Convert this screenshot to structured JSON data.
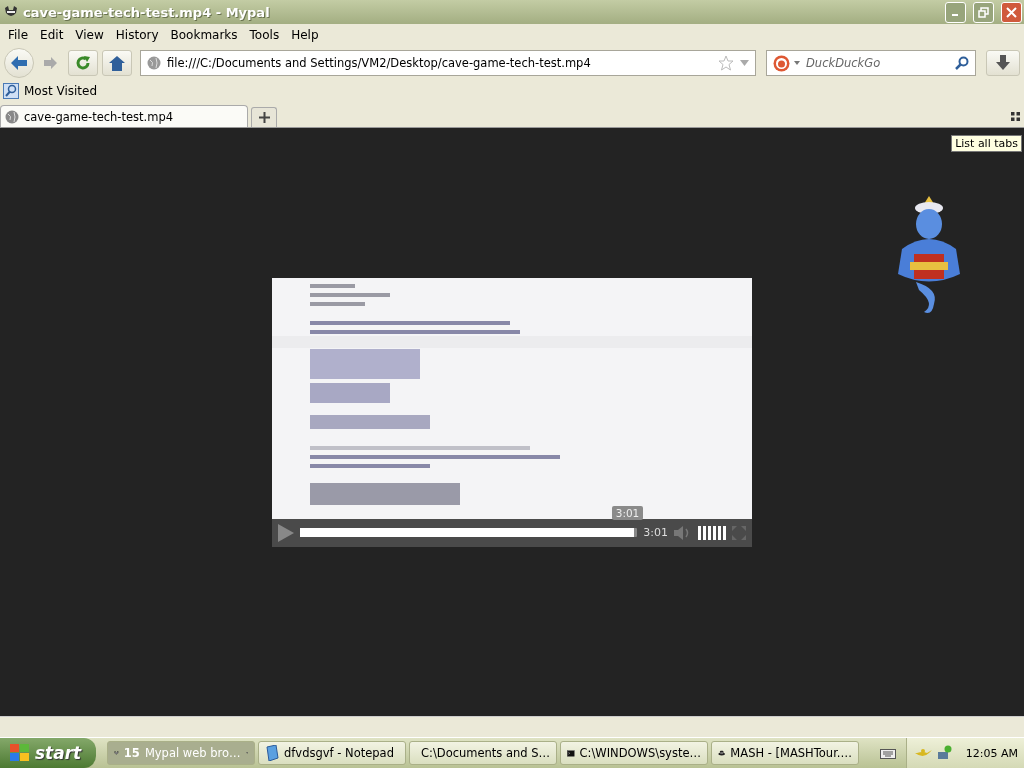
{
  "window": {
    "title": "cave-game-tech-test.mp4 - Mypal"
  },
  "menu": [
    {
      "label": "File"
    },
    {
      "label": "Edit"
    },
    {
      "label": "View"
    },
    {
      "label": "History"
    },
    {
      "label": "Bookmarks"
    },
    {
      "label": "Tools"
    },
    {
      "label": "Help"
    }
  ],
  "address": {
    "value": "file:///C:/Documents and Settings/VM2/Desktop/cave-game-tech-test.mp4"
  },
  "search": {
    "placeholder": "DuckDuckGo"
  },
  "bookmarks": [
    {
      "label": "Most Visited"
    }
  ],
  "tabs": [
    {
      "label": "cave-game-tech-test.mp4",
      "selected": true
    }
  ],
  "tooltip": "List all tabs",
  "video": {
    "kind": "picture",
    "player": {
      "level": 0.99,
      "hover_time": "3:01",
      "time": "3:01",
      "volume": {
        "level": 1
      }
    }
  },
  "taskbar": {
    "start": "start",
    "items": [
      {
        "kind": "browser",
        "count": "15",
        "label": "Mypal web bro…",
        "selected": true
      },
      {
        "kind": "notepad",
        "label": "dfvdsgvf - Notepad",
        "selected": false
      },
      {
        "kind": "archiver",
        "label": "C:\\Documents and S…",
        "selected": false
      },
      {
        "kind": "console",
        "label": "C:\\WINDOWS\\syste…",
        "selected": false
      },
      {
        "kind": "mash",
        "label": "MASH - [MASHTour.…",
        "selected": false
      }
    ],
    "clock": "12:05 AM"
  }
}
